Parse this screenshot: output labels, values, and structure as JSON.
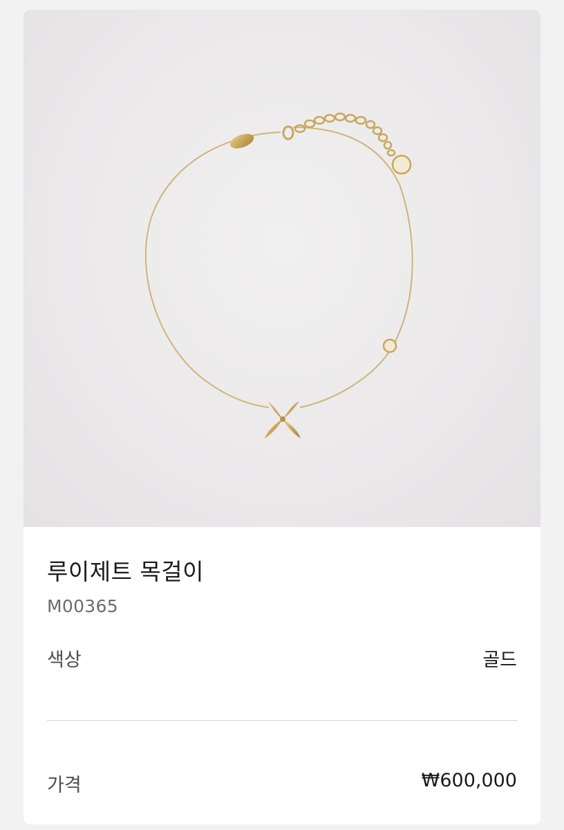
{
  "product": {
    "name": "루이제트 목걸이",
    "sku": "M00365",
    "image_icon": "necklace-product-image",
    "accent_color": "#c9a65a"
  },
  "details": {
    "color_label": "색상",
    "color_value": "골드",
    "price_label": "가격",
    "price_value": "₩600,000"
  }
}
